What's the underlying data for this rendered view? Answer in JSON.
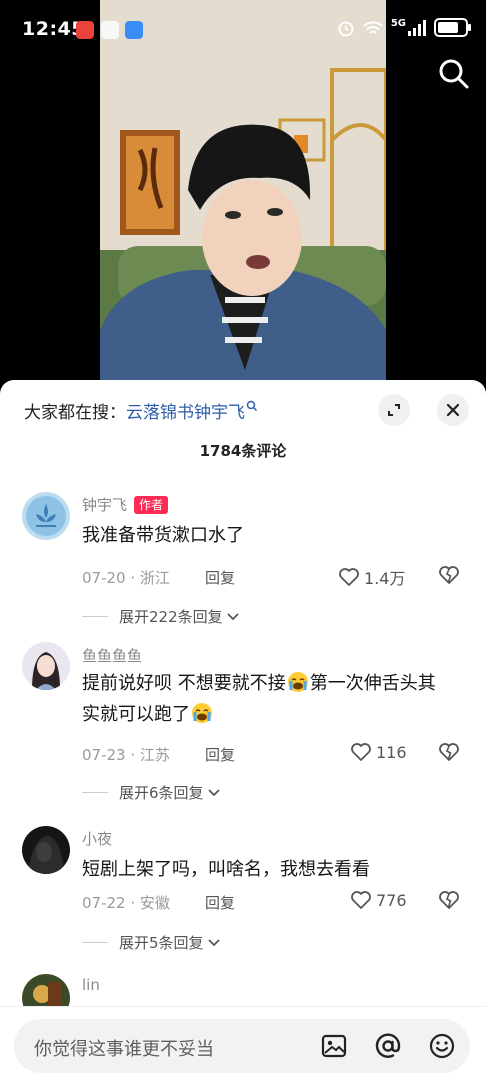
{
  "status_bar": {
    "time": "12:45",
    "network": "5G",
    "icons": [
      "alarm-icon",
      "wifi-icon",
      "signal-icon",
      "battery-icon"
    ]
  },
  "video": {
    "search_icon": "search-icon"
  },
  "sheet": {
    "hot_search_prefix": "大家都在搜：",
    "hot_search_keyword": "云落锦书钟宇飞",
    "comment_count": "1784条评论",
    "comments": [
      {
        "name": "钟宇飞",
        "badge": "作者",
        "text": "我准备带货漱口水了",
        "date": "07-20",
        "location": "浙江",
        "reply_label": "回复",
        "likes": "1.4万",
        "expand_label": "展开222条回复"
      },
      {
        "name": "鱼鱼鱼鱼",
        "text_part1": "提前说好呗 不想要就不接",
        "text_part2": "第一次伸舌头其实就可以跑了",
        "date": "07-23",
        "location": "江苏",
        "reply_label": "回复",
        "likes": "116",
        "expand_label": "展开6条回复"
      },
      {
        "name": "小夜",
        "text": "短剧上架了吗，叫啥名，我想去看看",
        "date": "07-22",
        "location": "安徽",
        "reply_label": "回复",
        "likes": "776",
        "expand_label": "展开5条回复"
      },
      {
        "name": "lin"
      }
    ]
  },
  "input_bar": {
    "placeholder": "你觉得这事谁更不妥当",
    "icons": [
      "image-icon",
      "at-icon",
      "emoji-icon"
    ]
  },
  "colors": {
    "accent": "#fe2c55",
    "keyword": "#2d5fa8",
    "text_primary": "#161616",
    "text_secondary": "#9a9a9a"
  }
}
